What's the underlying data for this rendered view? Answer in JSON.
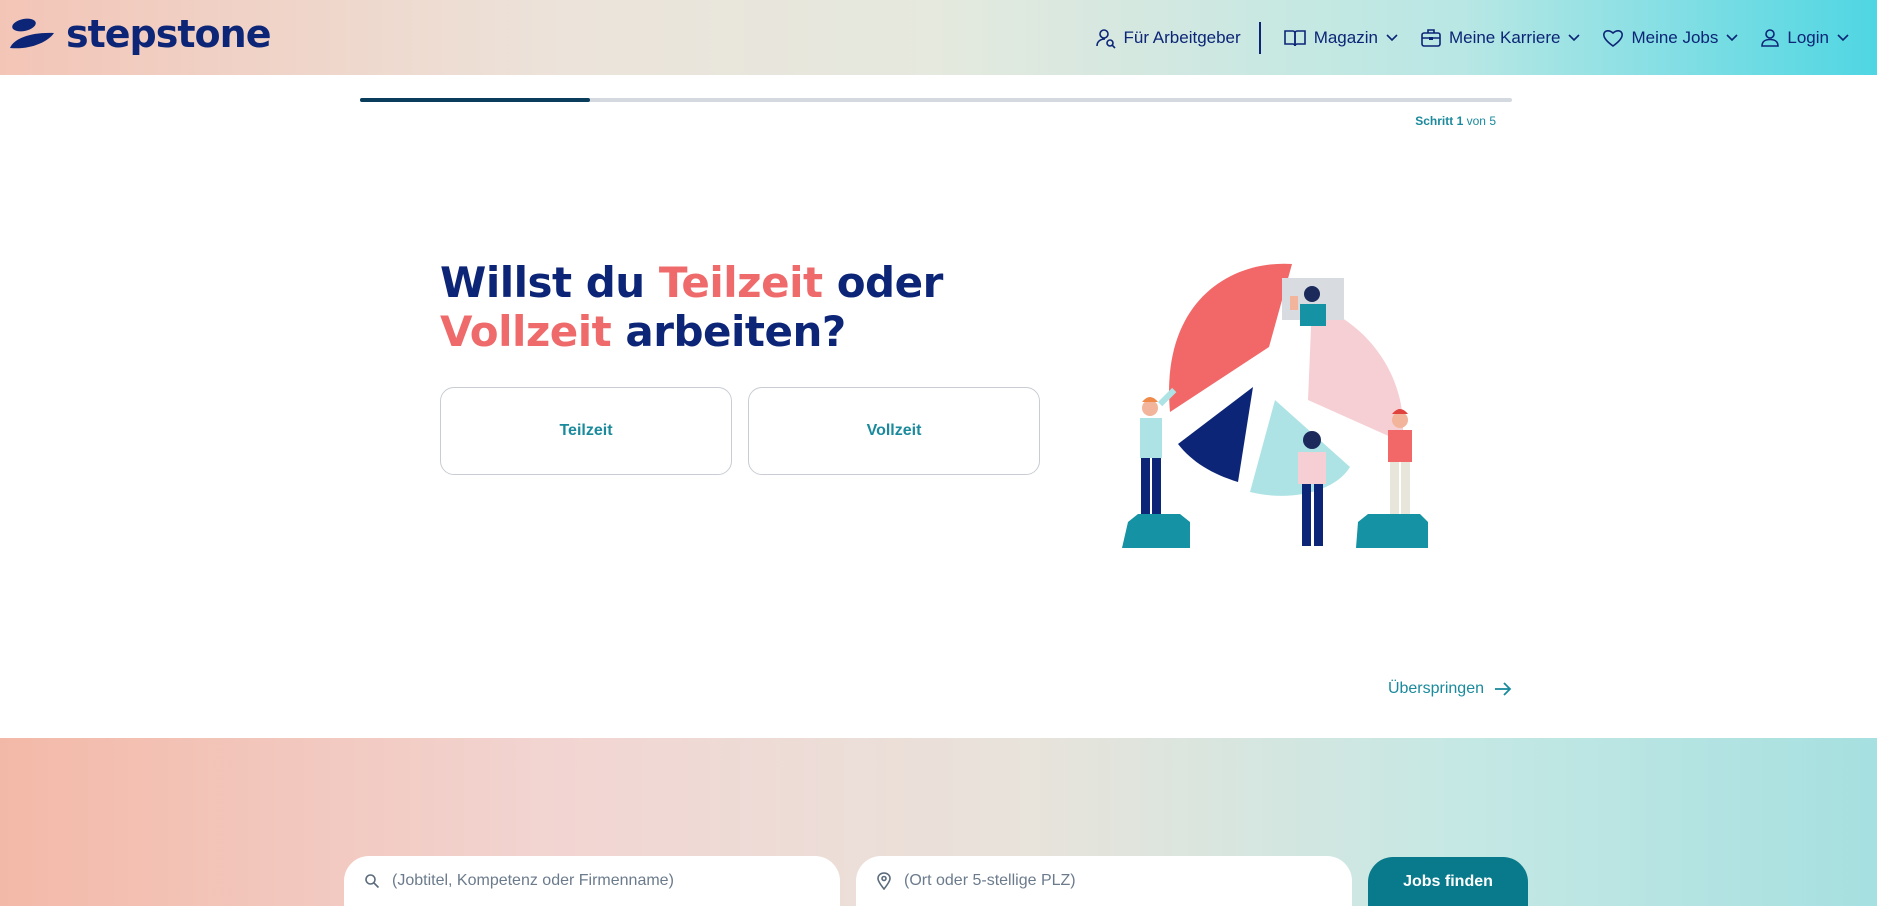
{
  "header": {
    "logo_text": "stepstone",
    "nav": [
      {
        "label": "Für Arbeitgeber",
        "icon": "person-search-icon"
      },
      {
        "label": "Magazin",
        "icon": "book-icon"
      },
      {
        "label": "Meine Karriere",
        "icon": "briefcase-icon"
      },
      {
        "label": "Meine Jobs",
        "icon": "heart-icon"
      },
      {
        "label": "Login",
        "icon": "user-icon"
      }
    ]
  },
  "progress": {
    "current": 1,
    "total": 5,
    "fraction": 0.2,
    "label_prefix": "Schritt",
    "label_of": "von"
  },
  "question": {
    "part1": "Willst du ",
    "highlight1": "Teilzeit",
    "part2": " oder ",
    "highlight2": "Vollzeit",
    "part3": " arbeiten?"
  },
  "options": [
    {
      "label": "Teilzeit"
    },
    {
      "label": "Vollzeit"
    }
  ],
  "skip_label": "Überspringen",
  "search": {
    "keyword_placeholder": "(Jobtitel, Kompetenz oder Firmenname)",
    "location_placeholder": "(Ort oder 5-stellige PLZ)",
    "button_label": "Jobs finden"
  },
  "colors": {
    "brand_navy": "#0c2577",
    "accent_coral": "#ef6b6b",
    "accent_teal": "#1a8a9c",
    "button_teal": "#087a8b"
  }
}
